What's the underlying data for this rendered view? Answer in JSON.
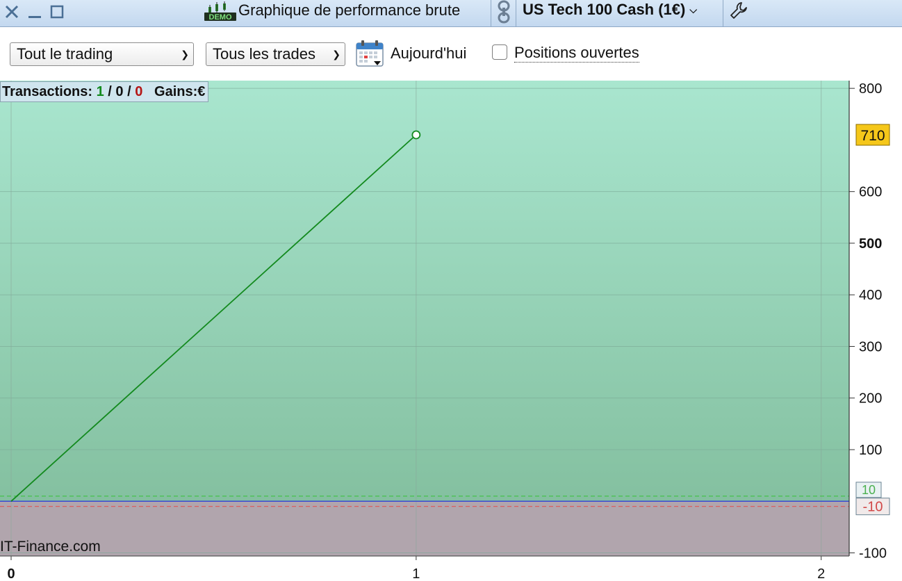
{
  "titlebar": {
    "title": "Graphique de performance brute",
    "demo_badge": "DEMO",
    "instrument": "US Tech 100 Cash (1€)"
  },
  "toolbar": {
    "filter_scope": "Tout le trading",
    "filter_trades": "Tous les trades",
    "date_label": "Aujourd'hui",
    "open_positions_label": "Positions ouvertes",
    "open_positions_checked": false
  },
  "stats": {
    "transactions_label": "Transactions:",
    "wins": "1",
    "neutral": "0",
    "losses": "0",
    "gains_label": "Gains:",
    "currency": "€"
  },
  "chart_data": {
    "type": "line",
    "x": [
      0,
      1
    ],
    "values": [
      0,
      710
    ],
    "xlim": [
      0,
      2.1
    ],
    "ylim": [
      -106,
      815
    ],
    "x_ticks": [
      "0",
      "1",
      "2"
    ],
    "y_ticks": [
      "800",
      "600",
      "500",
      "400",
      "300",
      "200",
      "100",
      "-100"
    ],
    "last_value_label": "710",
    "upper_band": 10,
    "lower_band": -10,
    "upper_band_label": "10",
    "lower_band_label": "-10",
    "colors": {
      "line": "#138a1e",
      "positive_area": "#a6e2cb",
      "negative_area": "#b1a5ad",
      "zero_line": "#3b49d4",
      "last_value_badge": "#f5c71a"
    }
  },
  "watermark": "IT-Finance.com"
}
